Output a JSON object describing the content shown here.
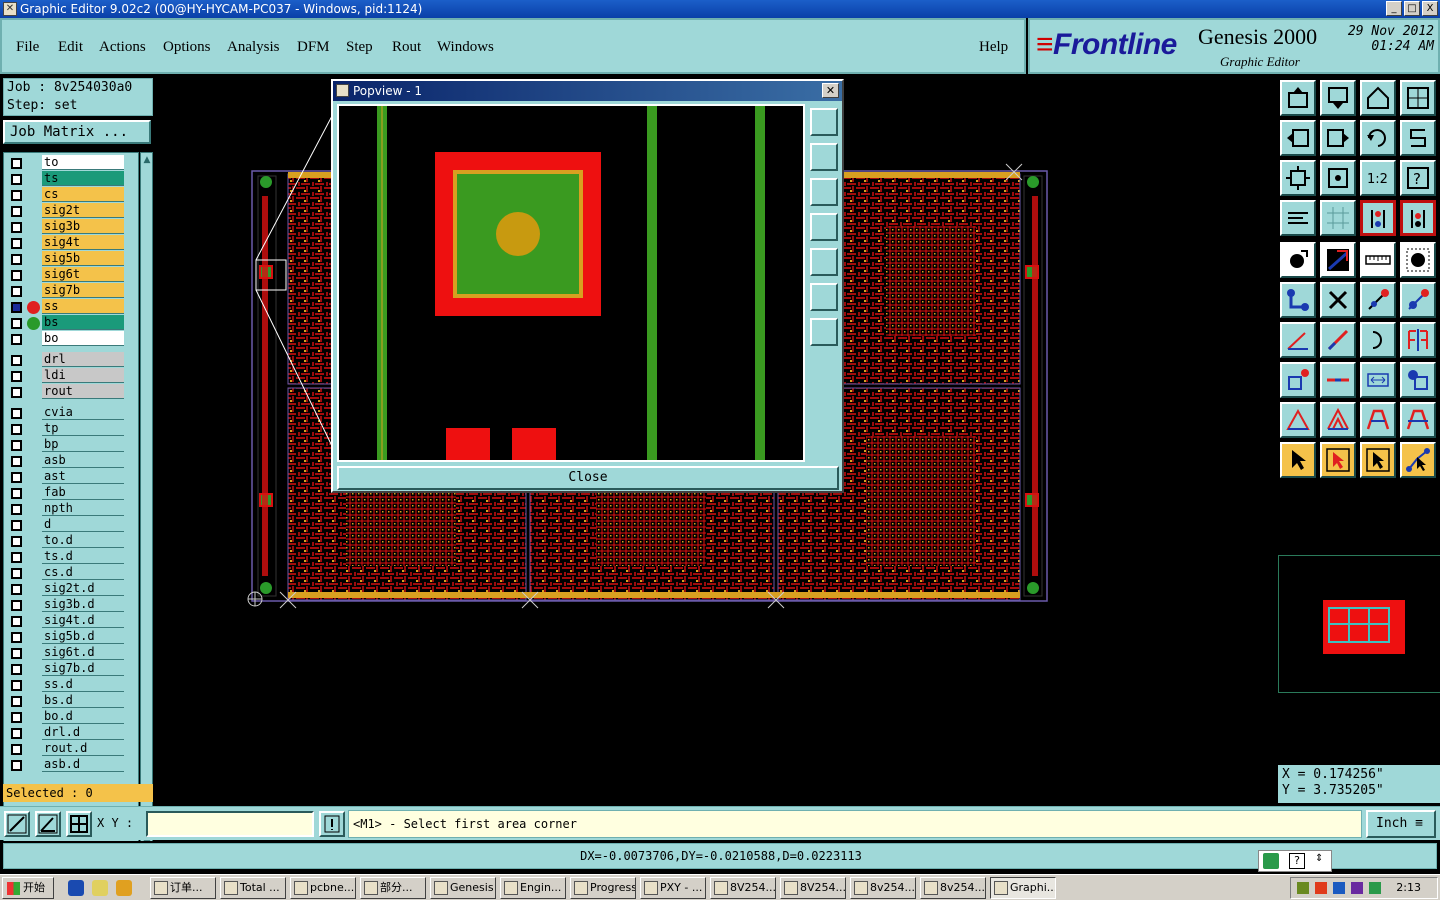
{
  "window": {
    "title": "Graphic Editor 9.02c2 (00@HY-HYCAM-PC037 - Windows, pid:1124)",
    "icon": "app-icon",
    "buttons": [
      "_",
      "□",
      "X"
    ]
  },
  "menu": {
    "items": [
      "File",
      "Edit",
      "Actions",
      "Options",
      "Analysis",
      "DFM",
      "Step",
      "Rout",
      "Windows"
    ],
    "help": "Help"
  },
  "brand": {
    "logo": "Frontline",
    "product": "Genesis 2000",
    "subtitle": "Graphic Editor",
    "date": "29 Nov 2012",
    "time": "01:24 AM"
  },
  "job": {
    "job_label": "Job : 8v254030a0",
    "step_label": "Step: set",
    "matrix_button": "Job Matrix ..."
  },
  "layers": [
    {
      "name": "to",
      "bg": "#ffffff",
      "dot": null
    },
    {
      "name": "ts",
      "bg": "#1a9a7a",
      "dot": null
    },
    {
      "name": "cs",
      "bg": "#f4c24a",
      "dot": null
    },
    {
      "name": "sig2t",
      "bg": "#f4c24a",
      "dot": null
    },
    {
      "name": "sig3b",
      "bg": "#f4c24a",
      "dot": null
    },
    {
      "name": "sig4t",
      "bg": "#f4c24a",
      "dot": null
    },
    {
      "name": "sig5b",
      "bg": "#f4c24a",
      "dot": null
    },
    {
      "name": "sig6t",
      "bg": "#f4c24a",
      "dot": null
    },
    {
      "name": "sig7b",
      "bg": "#f4c24a",
      "dot": null
    },
    {
      "name": "ss",
      "bg": "#f4c24a",
      "dot": "#e02020",
      "checked": true
    },
    {
      "name": "bs",
      "bg": "#1a9a7a",
      "dot": "#2a9a2a"
    },
    {
      "name": "bo",
      "bg": "#ffffff",
      "dot": null
    },
    {
      "name": "drl",
      "bg": "#c8c8c8",
      "dot": null,
      "gap": true
    },
    {
      "name": "ldi",
      "bg": "#c8c8c8",
      "dot": null
    },
    {
      "name": "rout",
      "bg": "#c8c8c8",
      "dot": null
    },
    {
      "name": "cvia",
      "bg": "#9fd8d8",
      "dot": null,
      "gap": true
    },
    {
      "name": "tp",
      "bg": "#9fd8d8",
      "dot": null
    },
    {
      "name": "bp",
      "bg": "#9fd8d8",
      "dot": null
    },
    {
      "name": "asb",
      "bg": "#9fd8d8",
      "dot": null
    },
    {
      "name": "ast",
      "bg": "#9fd8d8",
      "dot": null
    },
    {
      "name": "fab",
      "bg": "#9fd8d8",
      "dot": null
    },
    {
      "name": "npth",
      "bg": "#9fd8d8",
      "dot": null
    },
    {
      "name": "d",
      "bg": "#9fd8d8",
      "dot": null
    },
    {
      "name": "to.d",
      "bg": "#9fd8d8",
      "dot": null
    },
    {
      "name": "ts.d",
      "bg": "#9fd8d8",
      "dot": null
    },
    {
      "name": "cs.d",
      "bg": "#9fd8d8",
      "dot": null
    },
    {
      "name": "sig2t.d",
      "bg": "#9fd8d8",
      "dot": null
    },
    {
      "name": "sig3b.d",
      "bg": "#9fd8d8",
      "dot": null
    },
    {
      "name": "sig4t.d",
      "bg": "#9fd8d8",
      "dot": null
    },
    {
      "name": "sig5b.d",
      "bg": "#9fd8d8",
      "dot": null
    },
    {
      "name": "sig6t.d",
      "bg": "#9fd8d8",
      "dot": null
    },
    {
      "name": "sig7b.d",
      "bg": "#9fd8d8",
      "dot": null
    },
    {
      "name": "ss.d",
      "bg": "#9fd8d8",
      "dot": null
    },
    {
      "name": "bs.d",
      "bg": "#9fd8d8",
      "dot": null
    },
    {
      "name": "bo.d",
      "bg": "#9fd8d8",
      "dot": null
    },
    {
      "name": "drl.d",
      "bg": "#9fd8d8",
      "dot": null
    },
    {
      "name": "rout.d",
      "bg": "#9fd8d8",
      "dot": null
    },
    {
      "name": "asb.d",
      "bg": "#9fd8d8",
      "dot": null
    }
  ],
  "selected_label": "Selected : 0",
  "popview": {
    "title": "Popview - 1",
    "close_label": "Close"
  },
  "coords": {
    "x": "X  = 0.174256\"",
    "y": "Y  = 3.735205\""
  },
  "command": {
    "xy_label": "X Y :",
    "xy_value": "",
    "prompt": "<M1> - Select first area corner",
    "unit": "Inch"
  },
  "status": {
    "delta": "DX=-0.0073706,DY=-0.0210588,D=0.0223113"
  },
  "taskbar": {
    "start": "开始",
    "tasks": [
      "订单...",
      "Total ...",
      "pcbne...",
      "部分...",
      "Genesis",
      "Engin...",
      "Progress",
      "PXY - ...",
      "8V254...",
      "8V254...",
      "8v254...",
      "8v254...",
      "Graphi..."
    ],
    "active_index": 12,
    "clock": "2:13"
  },
  "colors": {
    "panel": "#9fd8d8",
    "copper": "#e01010",
    "pad": "#d8a020",
    "mask": "#3a9a20",
    "tool_yellow": "#f4c24a"
  }
}
